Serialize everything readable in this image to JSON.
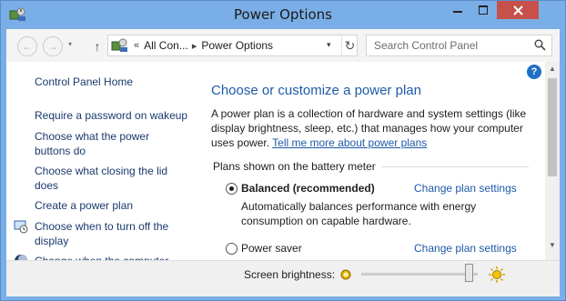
{
  "window": {
    "title": "Power Options",
    "controls": [
      "minimize",
      "maximize",
      "close"
    ]
  },
  "address": {
    "breadcrumb_prefix": "«",
    "breadcrumb": [
      "All Con...",
      "Power Options"
    ],
    "search_placeholder": "Search Control Panel"
  },
  "sidebar": {
    "home": "Control Panel Home",
    "links": [
      "Require a password on wakeup",
      "Choose what the power buttons do",
      "Choose what closing the lid does",
      "Create a power plan",
      "Choose when to turn off the display",
      "Change when the computer sleeps"
    ]
  },
  "main": {
    "title": "Choose or customize a power plan",
    "description": "A power plan is a collection of hardware and system settings (like display brightness, sleep, etc.) that manages how your computer uses power.",
    "description_link": "Tell me more about power plans",
    "plans_header": "Plans shown on the battery meter",
    "plans": [
      {
        "name": "Balanced (recommended)",
        "selected": true,
        "change_label": "Change plan settings",
        "description": "Automatically balances performance with energy consumption on capable hardware."
      },
      {
        "name": "Power saver",
        "selected": false,
        "change_label": "Change plan settings",
        "description": ""
      }
    ]
  },
  "bottom": {
    "brightness_label": "Screen brightness:",
    "brightness_level": 0.95
  },
  "colors": {
    "titlebar": "#7aaee6",
    "link": "#1e5aa8",
    "close": "#c7504b"
  }
}
